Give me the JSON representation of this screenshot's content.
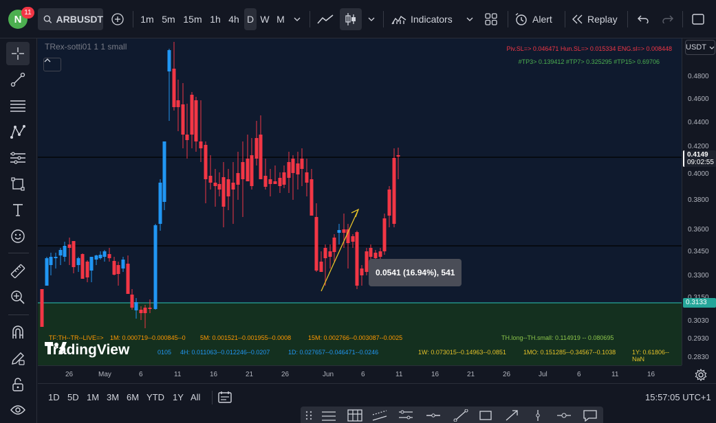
{
  "top_bar": {
    "avatar_letter": "N",
    "notification_count": "11",
    "symbol": "ARBUSDT",
    "intervals": [
      "1m",
      "5m",
      "15m",
      "1h",
      "4h",
      "D",
      "W",
      "M"
    ],
    "selected_interval": "D",
    "indicators_label": "Indicators",
    "alert_label": "Alert",
    "replay_label": "Replay"
  },
  "chart": {
    "indicator_name": "TRex-sotti01 1 1 small",
    "currency": "USDT",
    "info_line_1": "Piv.SL=> 0.046471  Hun.SL=> 0.015334  ENG.sl=> 0.008448",
    "info_line_2": "#TP3> 0.139412  #TP7> 0.325295  #TP15> 0.69706",
    "measure_label": "0.0541 (16.94%), 541",
    "row1_left": "TF:TH--TR--LIVE=>",
    "row1_1m": "1M: 0.000719--0.000845--0",
    "row1_5m": "5M: 0.001521--0.001955--0.0008",
    "row1_15m": "15M: 0.002766--0.003087--0.0025",
    "row1_right": "TH.long--TH.small: 0.114919 -- 0.080695",
    "row2_frag": "0105",
    "row2_4h": "4H: 0.011063--0.012246--0.0207",
    "row2_1d": "1D: 0.027657--0.046471--0.0246",
    "row2_1w": "1W: 0.073015--0.14963--0.0851",
    "row2_1mo": "1MO: 0.151285--0.34567--0.1038",
    "row2_1y": "1Y: 0.61806--NaN",
    "logo_text": "TradingView",
    "price_labels": [
      "0.4800",
      "0.4600",
      "0.4400",
      "0.4200",
      "0.4000",
      "0.3800",
      "0.3600",
      "0.3450",
      "0.3300",
      "0.3150",
      "0.3030",
      "0.2930",
      "0.2830"
    ],
    "last_price": "0.4149",
    "countdown": "09:02:55",
    "line_price": "0.3133",
    "time_labels": [
      "26",
      "May",
      "6",
      "11",
      "16",
      "21",
      "26",
      "Jun",
      "6",
      "11",
      "16",
      "21",
      "26",
      "Jul",
      "6",
      "11",
      "16"
    ],
    "colors": {
      "up": "#2196f3",
      "down": "#f23645",
      "line": "#26a69a"
    }
  },
  "bottom_bar": {
    "ranges": [
      "1D",
      "5D",
      "1M",
      "3M",
      "6M",
      "YTD",
      "1Y",
      "All"
    ],
    "clock": "15:57:05 UTC+1"
  },
  "icons": [
    "search-icon",
    "plus-icon",
    "chevron-down-icon",
    "line-chart-icon",
    "candles-icon",
    "indicators-icon",
    "layout-icon",
    "alarm-icon",
    "replay-icon",
    "undo-icon",
    "redo-icon",
    "fullscreen-icon",
    "crosshair-icon",
    "trendline-icon",
    "fib-icon",
    "pattern-icon",
    "forecast-icon",
    "shapes-icon",
    "text-icon",
    "emoji-icon",
    "ruler-icon",
    "zoom-icon",
    "magnet-icon",
    "pencil-lock-icon",
    "lock-icon",
    "eye-icon",
    "settings-icon",
    "calendar-icon"
  ]
}
